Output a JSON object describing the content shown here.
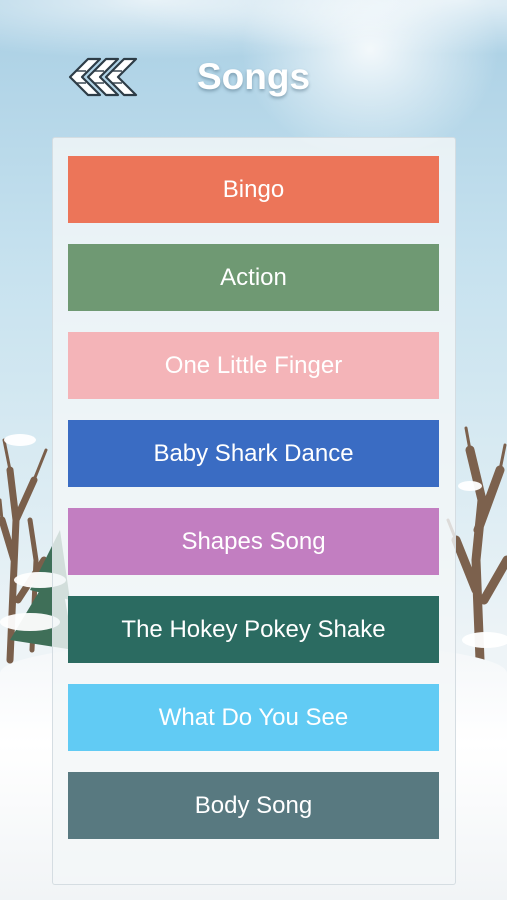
{
  "header": {
    "title": "Songs",
    "back_icon": "back-arrow-icon"
  },
  "songs": [
    {
      "label": "Bingo",
      "color": "#ec7559"
    },
    {
      "label": "Action",
      "color": "#6f9973"
    },
    {
      "label": "One Little Finger",
      "color": "#f4b4b8"
    },
    {
      "label": "Baby Shark Dance",
      "color": "#3a6cc3"
    },
    {
      "label": "Shapes Song",
      "color": "#c27ec1"
    },
    {
      "label": "The Hokey Pokey Shake",
      "color": "#2b6b61"
    },
    {
      "label": "What Do You See",
      "color": "#61cbf4"
    },
    {
      "label": "Body Song",
      "color": "#587980"
    }
  ]
}
